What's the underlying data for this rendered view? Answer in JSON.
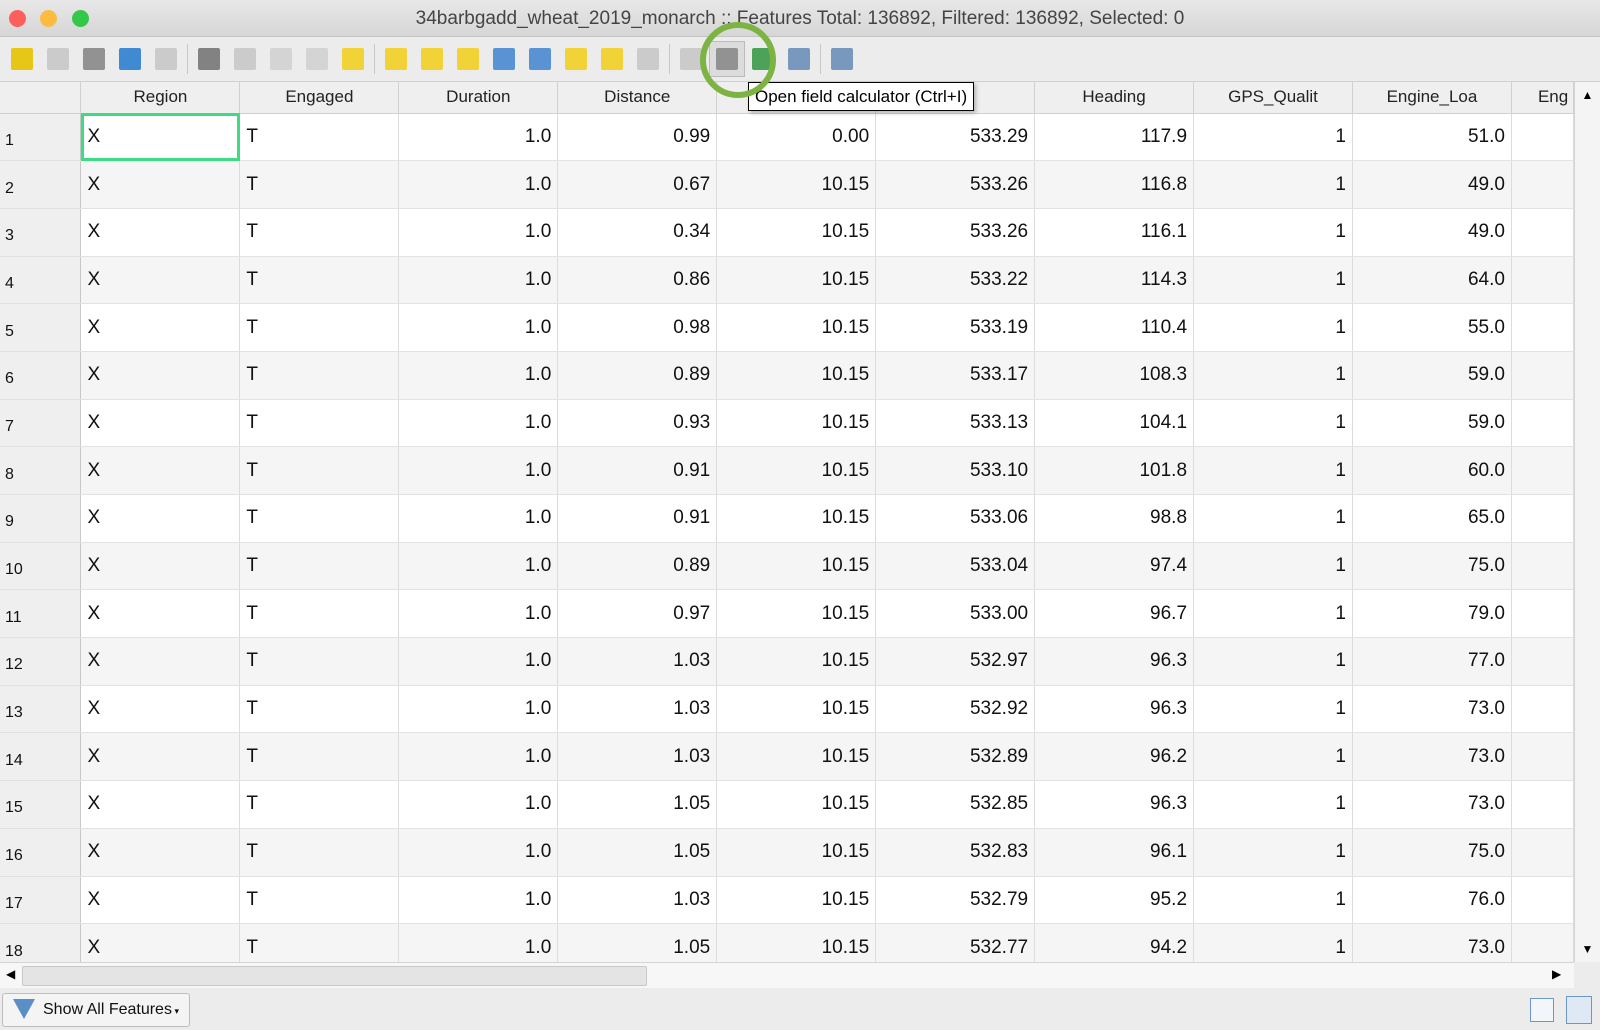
{
  "window": {
    "title": "34barbgadd_wheat_2019_monarch :: Features Total: 136892, Filtered: 136892, Selected: 0"
  },
  "toolbar": {
    "tools": [
      "pencil-icon",
      "edit-multiple-icon",
      "save-icon",
      "refresh-icon",
      "add-feature-icon",
      "delete-icon",
      "cut-icon",
      "copy-icon",
      "paste-icon",
      "select-by-expression-icon",
      "select-all-icon",
      "invert-selection-icon",
      "deselect-icon",
      "filter-icon",
      "move-to-top-icon",
      "pan-to-selection-icon",
      "zoom-to-selection-icon",
      "new-field-icon",
      "delete-field-icon",
      "field-calculator-icon",
      "conditional-formatting-icon",
      "dock-icon",
      "actions-icon"
    ]
  },
  "tooltip": "Open field calculator (Ctrl+I)",
  "colors": {
    "selected_cell": "#3ddc84",
    "highlight_circle": "#7cb342"
  },
  "table": {
    "headers": [
      "Region",
      "Engaged",
      "Duration",
      "Distance",
      "",
      "",
      "Heading",
      "GPS_Qualit",
      "Engine_Loa",
      "Eng"
    ],
    "rows": [
      [
        "1",
        "X",
        "T",
        "1.0",
        "0.99",
        "0.00",
        "533.29",
        "117.9",
        "1",
        "51.0"
      ],
      [
        "2",
        "X",
        "T",
        "1.0",
        "0.67",
        "10.15",
        "533.26",
        "116.8",
        "1",
        "49.0"
      ],
      [
        "3",
        "X",
        "T",
        "1.0",
        "0.34",
        "10.15",
        "533.26",
        "116.1",
        "1",
        "49.0"
      ],
      [
        "4",
        "X",
        "T",
        "1.0",
        "0.86",
        "10.15",
        "533.22",
        "114.3",
        "1",
        "64.0"
      ],
      [
        "5",
        "X",
        "T",
        "1.0",
        "0.98",
        "10.15",
        "533.19",
        "110.4",
        "1",
        "55.0"
      ],
      [
        "6",
        "X",
        "T",
        "1.0",
        "0.89",
        "10.15",
        "533.17",
        "108.3",
        "1",
        "59.0"
      ],
      [
        "7",
        "X",
        "T",
        "1.0",
        "0.93",
        "10.15",
        "533.13",
        "104.1",
        "1",
        "59.0"
      ],
      [
        "8",
        "X",
        "T",
        "1.0",
        "0.91",
        "10.15",
        "533.10",
        "101.8",
        "1",
        "60.0"
      ],
      [
        "9",
        "X",
        "T",
        "1.0",
        "0.91",
        "10.15",
        "533.06",
        "98.8",
        "1",
        "65.0"
      ],
      [
        "10",
        "X",
        "T",
        "1.0",
        "0.89",
        "10.15",
        "533.04",
        "97.4",
        "1",
        "75.0"
      ],
      [
        "11",
        "X",
        "T",
        "1.0",
        "0.97",
        "10.15",
        "533.00",
        "96.7",
        "1",
        "79.0"
      ],
      [
        "12",
        "X",
        "T",
        "1.0",
        "1.03",
        "10.15",
        "532.97",
        "96.3",
        "1",
        "77.0"
      ],
      [
        "13",
        "X",
        "T",
        "1.0",
        "1.03",
        "10.15",
        "532.92",
        "96.3",
        "1",
        "73.0"
      ],
      [
        "14",
        "X",
        "T",
        "1.0",
        "1.03",
        "10.15",
        "532.89",
        "96.2",
        "1",
        "73.0"
      ],
      [
        "15",
        "X",
        "T",
        "1.0",
        "1.05",
        "10.15",
        "532.85",
        "96.3",
        "1",
        "73.0"
      ],
      [
        "16",
        "X",
        "T",
        "1.0",
        "1.05",
        "10.15",
        "532.83",
        "96.1",
        "1",
        "75.0"
      ],
      [
        "17",
        "X",
        "T",
        "1.0",
        "1.03",
        "10.15",
        "532.79",
        "95.2",
        "1",
        "76.0"
      ],
      [
        "18",
        "X",
        "T",
        "1.0",
        "1.05",
        "10.15",
        "532.77",
        "94.2",
        "1",
        "73.0"
      ]
    ]
  },
  "footer": {
    "filter_label": "Show All Features"
  }
}
